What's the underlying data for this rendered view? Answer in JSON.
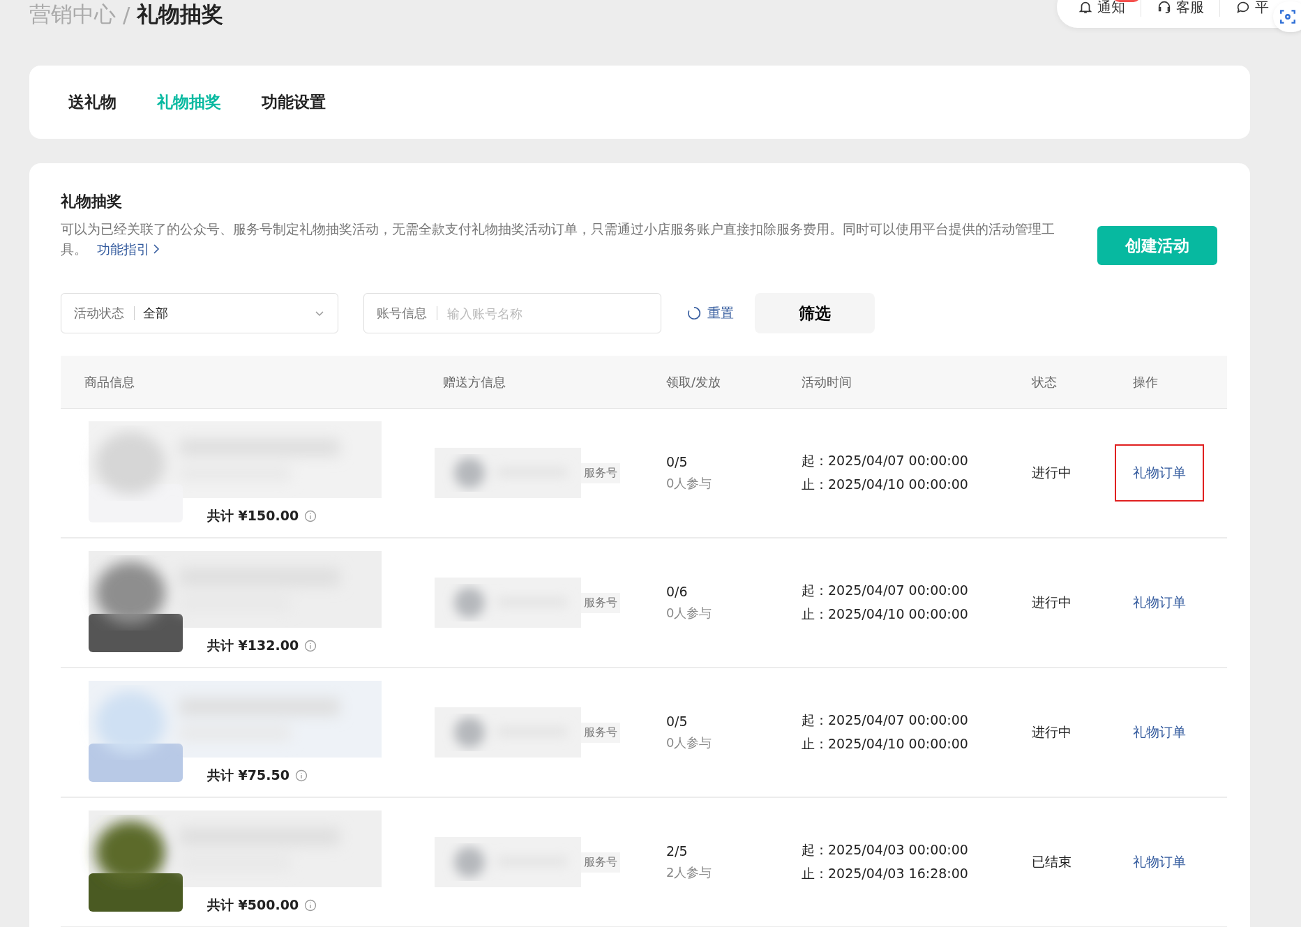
{
  "breadcrumb": {
    "parent": "营销中心",
    "separator": "/",
    "current": "礼物抽奖"
  },
  "top_bar": {
    "items": [
      {
        "kind": "bell",
        "label": "通知",
        "badge": true
      },
      {
        "kind": "headset",
        "label": "客服",
        "badge": false
      },
      {
        "kind": "chat",
        "label": "平",
        "badge": false
      }
    ]
  },
  "tabs": [
    {
      "label": "送礼物",
      "selected": false
    },
    {
      "label": "礼物抽奖",
      "selected": true
    },
    {
      "label": "功能设置",
      "selected": false
    }
  ],
  "section": {
    "title": "礼物抽奖",
    "description": "可以为已经关联了的公众号、服务号制定礼物抽奖活动，无需全款支付礼物抽奖活动订单，只需通过小店服务账户直接扣除服务费用。同时可以使用平台提供的活动管理工具。",
    "guide_link": "功能指引",
    "create_button": "创建活动"
  },
  "filters": {
    "status": {
      "label": "活动状态",
      "value": "全部"
    },
    "account": {
      "label": "账号信息",
      "placeholder": "输入账号名称"
    },
    "reset": "重置",
    "submit": "筛选"
  },
  "table": {
    "columns": [
      "商品信息",
      "赠送方信息",
      "领取/发放",
      "活动时间",
      "状态",
      "操作"
    ],
    "rows": [
      {
        "total": "共计 ¥150.00",
        "sender_tag": "服务号",
        "claimed": "0/5",
        "participants": "0人参与",
        "start": "起：2025/04/07 00:00:00",
        "end": "止：2025/04/10 00:00:00",
        "status": "进行中",
        "action": "礼物订单",
        "highlighted": true
      },
      {
        "total": "共计 ¥132.00",
        "sender_tag": "服务号",
        "claimed": "0/6",
        "participants": "0人参与",
        "start": "起：2025/04/07 00:00:00",
        "end": "止：2025/04/10 00:00:00",
        "status": "进行中",
        "action": "礼物订单",
        "highlighted": false
      },
      {
        "total": "共计 ¥75.50",
        "sender_tag": "服务号",
        "claimed": "0/5",
        "participants": "0人参与",
        "start": "起：2025/04/07 00:00:00",
        "end": "止：2025/04/10 00:00:00",
        "status": "进行中",
        "action": "礼物订单",
        "highlighted": false
      },
      {
        "total": "共计 ¥500.00",
        "sender_tag": "服务号",
        "claimed": "2/5",
        "participants": "2人参与",
        "start": "起：2025/04/03 00:00:00",
        "end": "止：2025/04/03 16:28:00",
        "status": "已结束",
        "action": "礼物订单",
        "highlighted": false
      }
    ]
  }
}
